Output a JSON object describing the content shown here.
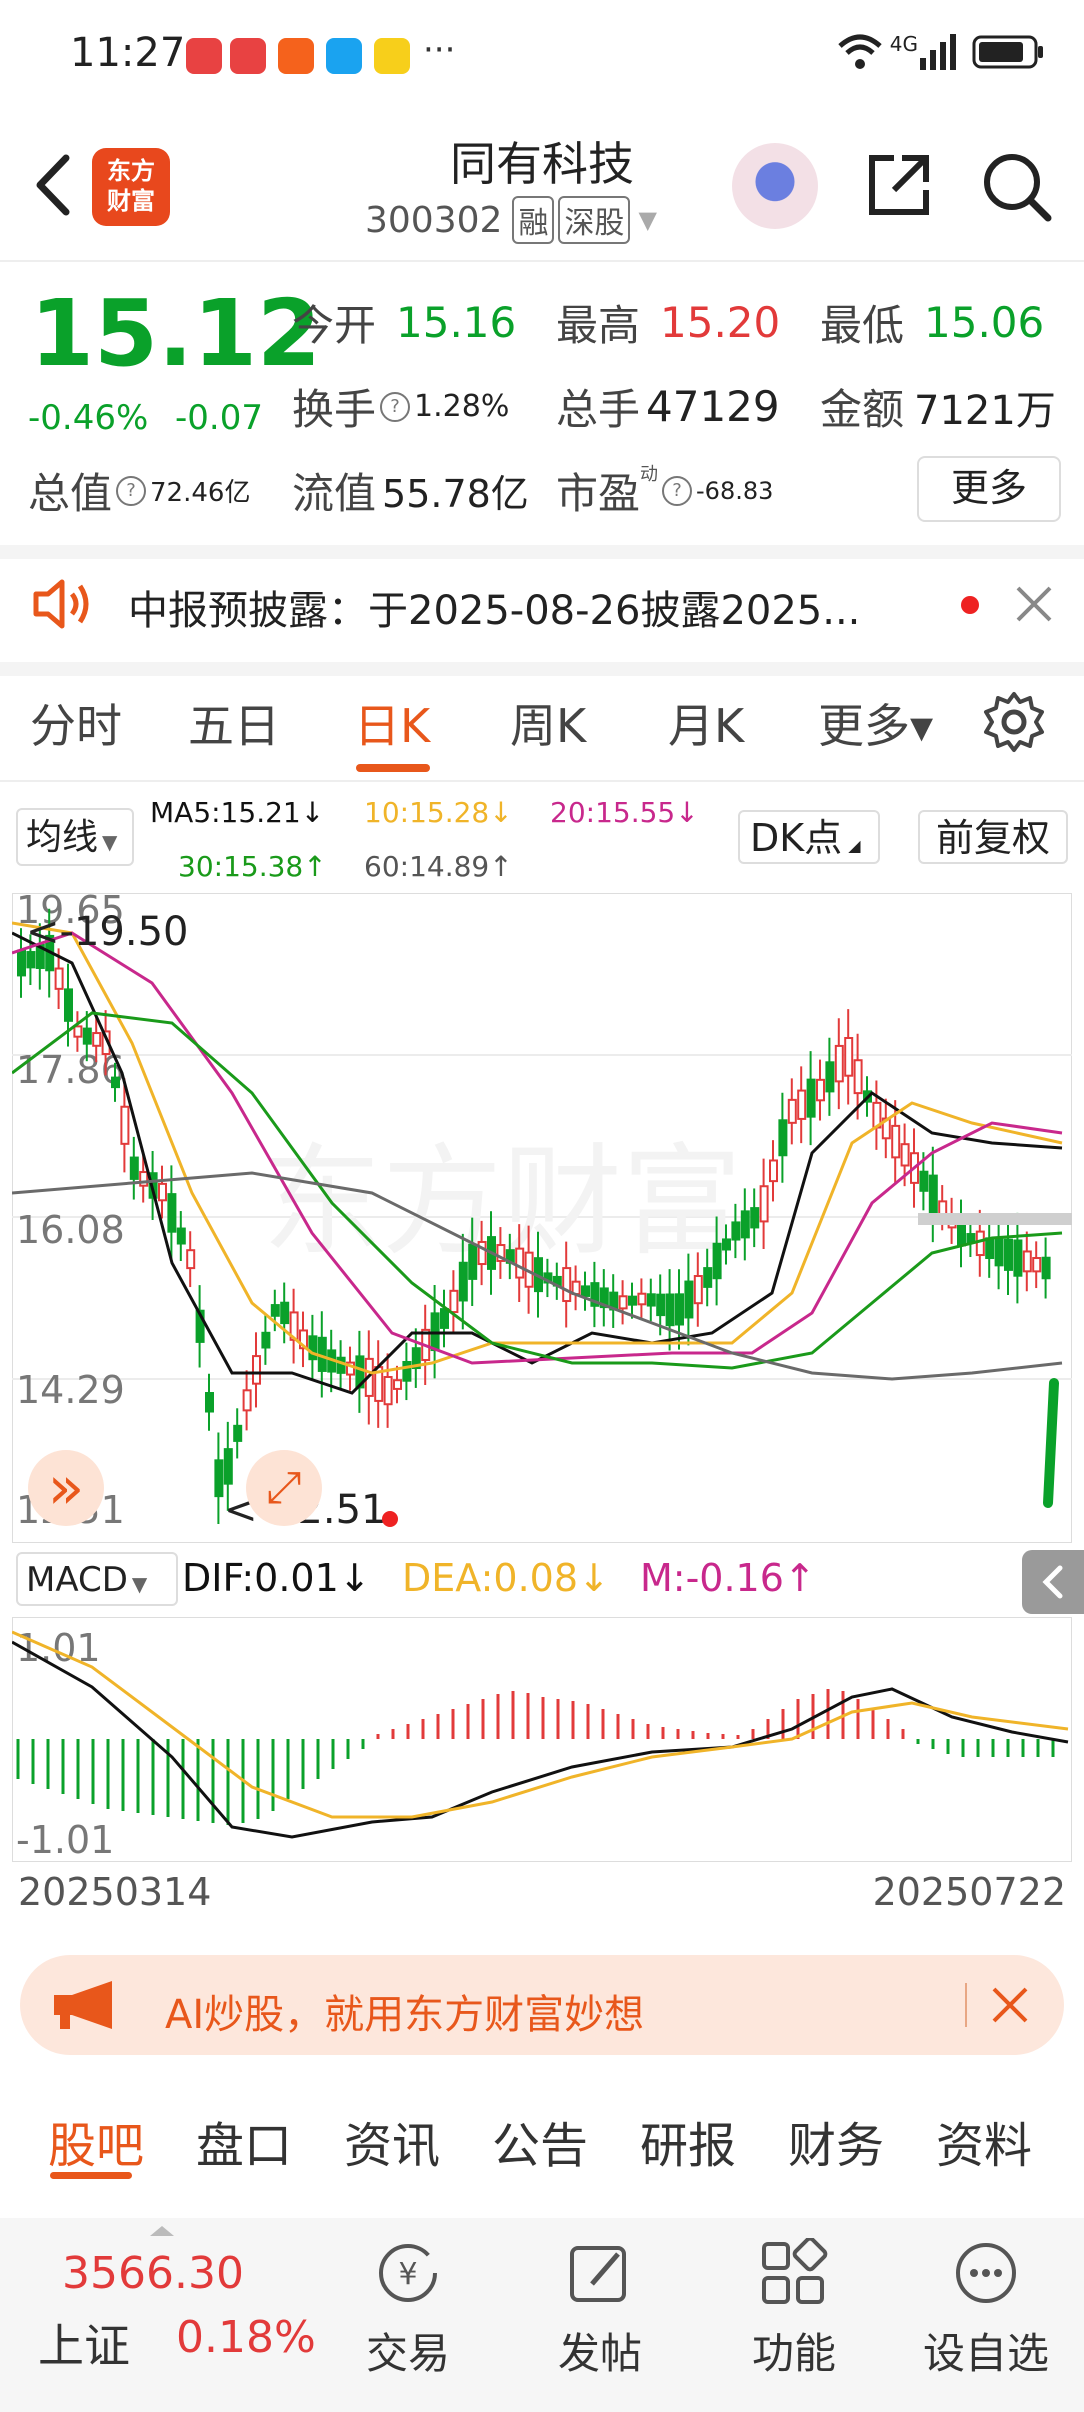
{
  "status_bar": {
    "time": "11:27",
    "network": "4G",
    "dots": "···"
  },
  "header": {
    "title": "同有科技",
    "code": "300302",
    "tag_margin": "融",
    "tag_market": "深股",
    "logo_text_line1": "东方",
    "logo_text_line2": "财富"
  },
  "quote": {
    "price": "15.12",
    "change_pct": "-0.46%",
    "change_abs": "-0.07",
    "open_label": "今开",
    "open": "15.16",
    "high_label": "最高",
    "high": "15.20",
    "low_label": "最低",
    "low": "15.06",
    "turnover_label": "换手",
    "turnover": "1.28%",
    "volume_label": "总手",
    "volume": "47129",
    "amount_label": "金额",
    "amount": "7121万",
    "mktcap_label": "总值",
    "mktcap": "72.46亿",
    "float_label": "流值",
    "float": "55.78亿",
    "pe_label": "市盈",
    "pe_sup": "动",
    "pe": "-68.83",
    "more_label": "更多"
  },
  "notice": {
    "text": "中报预披露：于2025-08-26披露2025..."
  },
  "chart_tabs": [
    {
      "label": "分时"
    },
    {
      "label": "五日"
    },
    {
      "label": "日K"
    },
    {
      "label": "周K"
    },
    {
      "label": "月K"
    },
    {
      "label": "更多▾"
    }
  ],
  "ma": {
    "selector": "均线",
    "ma5": "MA5:15.21↓",
    "ma10": "10:15.28↓",
    "ma20": "20:15.55↓",
    "ma30": "30:15.38↑",
    "ma60": "60:14.89↑",
    "dk_label": "DK点",
    "fq_label": "前复权"
  },
  "colors": {
    "up": "#e23a3a",
    "down": "#0aa12a",
    "accent": "#e8571b",
    "ma5": "#111111",
    "ma10": "#f0b429",
    "ma20": "#c8288c",
    "ma30": "#1a9a1a",
    "ma60": "#6a6a6a"
  },
  "chart_data": {
    "type": "candlestick",
    "yticks": [
      "19.65",
      "17.86",
      "16.08",
      "14.29",
      "12.51"
    ],
    "ylim": [
      12.51,
      19.65
    ],
    "max_label": "<-19.50",
    "min_label": "<-12.51",
    "x_start": "20250314",
    "x_end": "20250722",
    "watermark": "东方财富"
  },
  "macd": {
    "selector": "MACD",
    "dif": "DIF:0.01↓",
    "dea": "DEA:0.08↓",
    "m": "M:-0.16↑",
    "ytop": "1.01",
    "ybot": "-1.01"
  },
  "ai_banner": {
    "text": "AI炒股，就用东方财富妙想"
  },
  "bottom_tabs": [
    {
      "label": "股吧"
    },
    {
      "label": "盘口"
    },
    {
      "label": "资讯"
    },
    {
      "label": "公告"
    },
    {
      "label": "研报"
    },
    {
      "label": "财务"
    },
    {
      "label": "资料"
    }
  ],
  "bottom_nav": {
    "index_value": "3566.30",
    "index_name": "上证",
    "index_pct": "0.18%",
    "trade": "交易",
    "post": "发帖",
    "func": "功能",
    "watch": "设自选"
  }
}
